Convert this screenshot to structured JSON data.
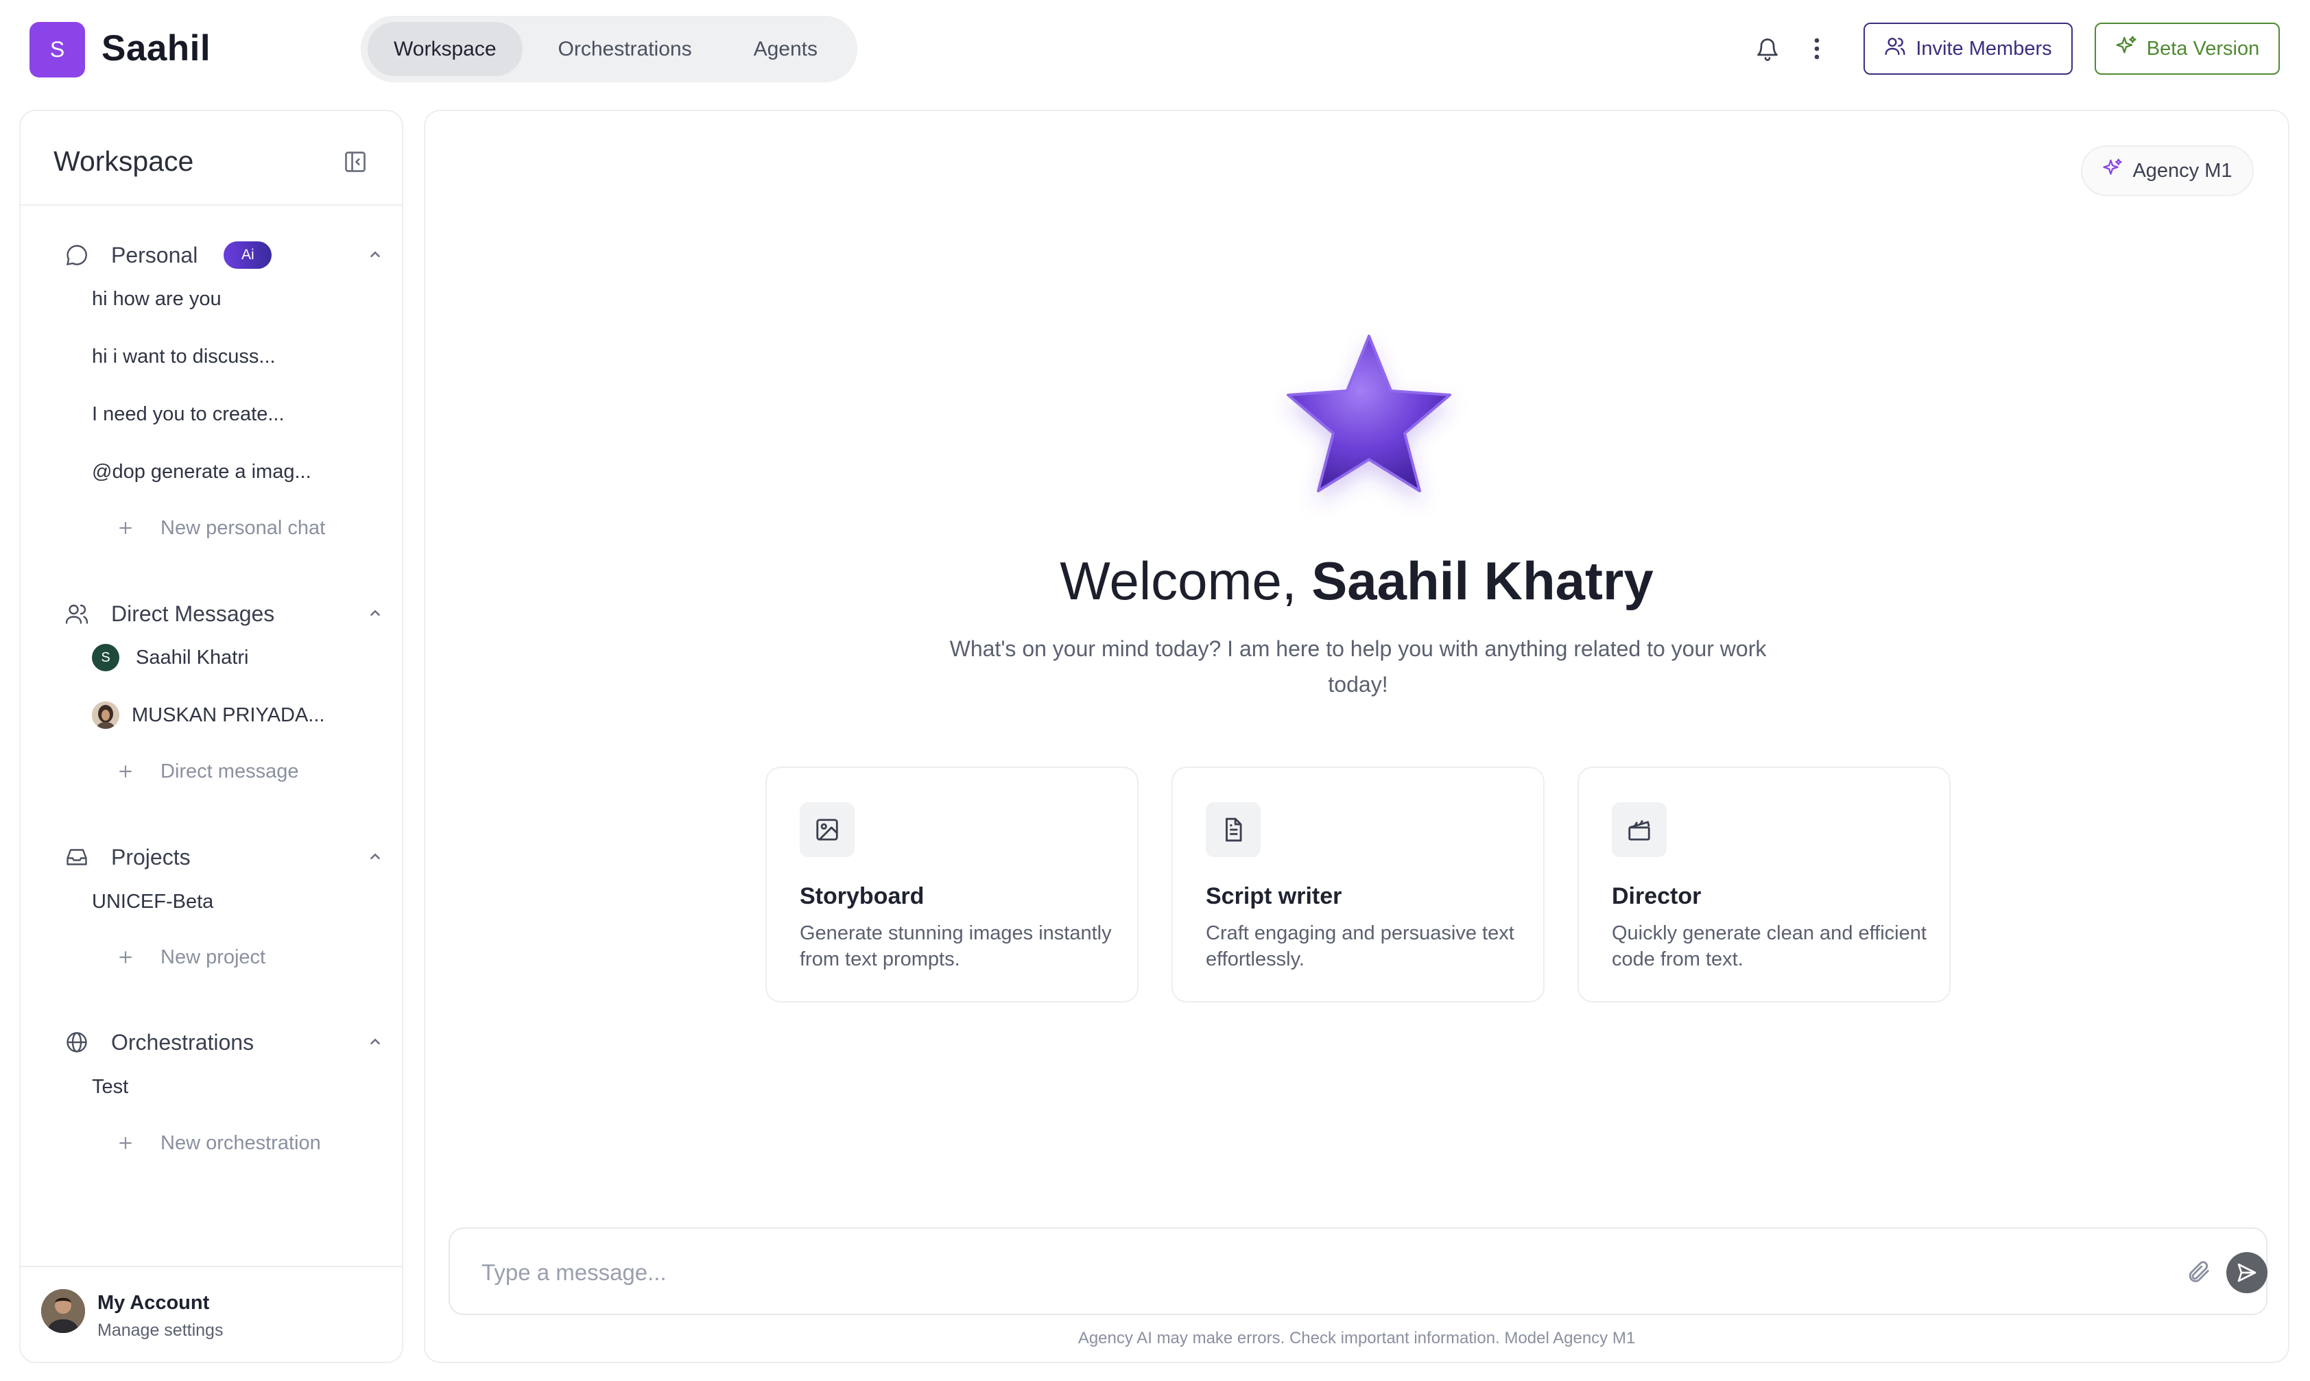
{
  "app": {
    "logo_letter": "S",
    "title": "Saahil"
  },
  "nav": {
    "tabs": [
      {
        "label": "Workspace",
        "active": true
      },
      {
        "label": "Orchestrations",
        "active": false
      },
      {
        "label": "Agents",
        "active": false
      }
    ]
  },
  "header_actions": {
    "notification_icon": "bell-icon",
    "more_icon": "kebab-icon",
    "invite_label": "Invite Members",
    "beta_label": "Beta Version"
  },
  "sidebar": {
    "title": "Workspace",
    "personal": {
      "label": "Personal",
      "badge": "Ai",
      "items": [
        "hi how are you",
        "hi i want to discuss...",
        "I need you to create...",
        "@dop generate a imag..."
      ],
      "add_label": "New personal chat"
    },
    "direct_messages": {
      "label": "Direct Messages",
      "items": [
        {
          "avatar": "S",
          "name": "Saahil Khatri"
        },
        {
          "avatar": "",
          "name": "MUSKAN PRIYADA..."
        }
      ],
      "add_label": "Direct message"
    },
    "projects": {
      "label": "Projects",
      "items": [
        "UNICEF-Beta"
      ],
      "add_label": "New project"
    },
    "orchestrations": {
      "label": "Orchestrations",
      "items": [
        "Test"
      ],
      "add_label": "New orchestration"
    },
    "account": {
      "name": "My Account",
      "subtitle": "Manage settings"
    }
  },
  "main": {
    "model_chip": "Agency M1",
    "welcome_prefix": "Welcome, ",
    "welcome_name": "Saahil Khatry",
    "welcome_sub": "What's on your mind today? I am here to help you with anything related to your work today!",
    "cards": [
      {
        "icon": "image-icon",
        "title": "Storyboard",
        "desc": "Generate stunning images instantly from text prompts."
      },
      {
        "icon": "document-icon",
        "title": "Script writer",
        "desc": "Craft engaging and persuasive text effortlessly."
      },
      {
        "icon": "clapperboard-icon",
        "title": "Director",
        "desc": "Quickly generate clean and efficient code from text."
      }
    ],
    "composer_placeholder": "Type a message...",
    "disclaimer": "Agency AI may make errors. Check important information. Model Agency M1"
  },
  "colors": {
    "brand_purple": "#8b44e8",
    "invite_border": "#3a2e7f",
    "beta_green": "#4e8a32",
    "star_purple": "#6b3fd6"
  }
}
